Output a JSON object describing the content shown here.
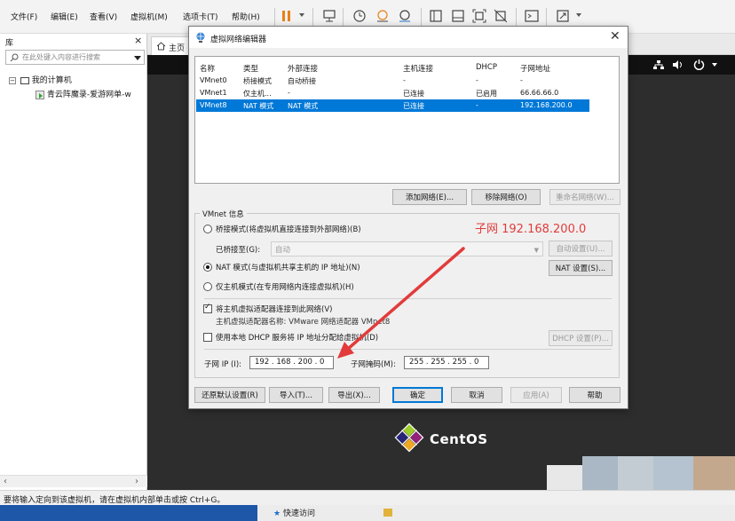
{
  "menubar": {
    "items": [
      "文件(F)",
      "编辑(E)",
      "查看(V)",
      "虚拟机(M)",
      "选项卡(T)",
      "帮助(H)"
    ]
  },
  "toolbar": {
    "icons": [
      "pause-icon",
      "send-keys-icon",
      "snapshot-icon",
      "revert-snapshot-icon",
      "snapshot-manager-icon",
      "fit-guest-icon",
      "console-view-icon",
      "full-screen-icon",
      "unity-icon",
      "terminal-icon",
      "stretch-icon"
    ],
    "accent": "#e8811a"
  },
  "library": {
    "title": "库",
    "search_placeholder": "在此处键入内容进行搜索",
    "root": "我的计算机",
    "vm_name": "青云阵魔录-爱游网单-w"
  },
  "tabs": {
    "home": "主页"
  },
  "dialog": {
    "title": "虚拟网络编辑器",
    "columns": [
      "名称",
      "类型",
      "外部连接",
      "主机连接",
      "DHCP",
      "子网地址"
    ],
    "rows": [
      {
        "name": "VMnet0",
        "type": "桥接模式",
        "external": "自动桥接",
        "host": "-",
        "dhcp": "-",
        "subnet": "-"
      },
      {
        "name": "VMnet1",
        "type": "仅主机...",
        "external": "-",
        "host": "已连接",
        "dhcp": "已启用",
        "subnet": "66.66.66.0"
      },
      {
        "name": "VMnet8",
        "type": "NAT 模式",
        "external": "NAT 模式",
        "host": "已连接",
        "dhcp": "-",
        "subnet": "192.168.200.0"
      }
    ],
    "selected_row": "VMnet8",
    "buttons": {
      "add": "添加网络(E)...",
      "remove": "移除网络(O)",
      "rename": "重命名网络(W)...",
      "auto_settings": "自动设置(U)...",
      "nat_settings": "NAT 设置(S)...",
      "dhcp_settings": "DHCP 设置(P)...",
      "restore": "还原默认设置(R)",
      "import": "导入(T)...",
      "export": "导出(X)...",
      "ok": "确定",
      "cancel": "取消",
      "apply": "应用(A)",
      "help": "帮助"
    },
    "vmnet_info": {
      "legend": "VMnet 信息",
      "bridged": "桥接模式(将虚拟机直接连接到外部网络)(B)",
      "bridged_to_label": "已桥接至(G):",
      "bridged_to_value": "自动",
      "nat": "NAT 模式(与虚拟机共享主机的 IP 地址)(N)",
      "host_only": "仅主机模式(在专用网络内连接虚拟机)(H)",
      "selected_mode": "nat",
      "connect_adapter": "将主机虚拟适配器连接到此网络(V)",
      "connect_adapter_checked": true,
      "adapter_name": "主机虚拟适配器名称: VMware 网络适配器 VMnet8",
      "use_dhcp": "使用本地 DHCP 服务将 IP 地址分配给虚拟机(D)",
      "use_dhcp_checked": false,
      "subnet_ip_label": "子网 IP (I):",
      "subnet_ip": "192 . 168 . 200 . 0",
      "subnet_mask_label": "子网掩码(M):",
      "subnet_mask": "255 . 255 . 255 . 0"
    }
  },
  "annotation": {
    "text": "子网 192.168.200.0",
    "color": "#e23b3b"
  },
  "console": {
    "os_name": "CentOS"
  },
  "statusbar": {
    "text": "要将输入定向到该虚拟机，请在虚拟机内部单击或按 Ctrl+G。"
  },
  "taskbar": {
    "quick_access": "快速访问"
  }
}
